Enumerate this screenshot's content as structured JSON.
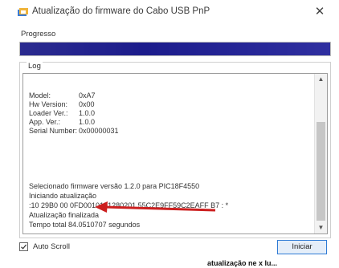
{
  "window": {
    "title": "Atualização do firmware do Cabo USB PnP",
    "close_glyph": "✕"
  },
  "progress": {
    "label": "Progresso",
    "value": 1.0,
    "color": "#1f1f8e"
  },
  "log": {
    "label": "Log",
    "device_info": [
      {
        "key": "Model:",
        "value": "0xA7"
      },
      {
        "key": "Hw Version:",
        "value": "0x00"
      },
      {
        "key": "Loader Ver.:",
        "value": "1.0.0"
      },
      {
        "key": "App. Ver.:",
        "value": "1.0.0"
      },
      {
        "key": "Serial Number:",
        "value": "0x00000031"
      }
    ],
    "lines": [
      "Selecionado firmware versão 1.2.0 para PIC18F4550",
      "Iniciando atualização",
      ":10 29B0 00 0FD0010151280201 55C2E9FF59C2EAFF B7 : *",
      "Atualização finalizada",
      "Tempo total 84.0510707 segundos"
    ],
    "annotation_color": "#cc1f1f"
  },
  "footer": {
    "autoscroll_label": "Auto Scroll",
    "autoscroll_checked": true,
    "start_button_label": "Iniciar"
  },
  "background_fragment": "atualização ne x lu..."
}
